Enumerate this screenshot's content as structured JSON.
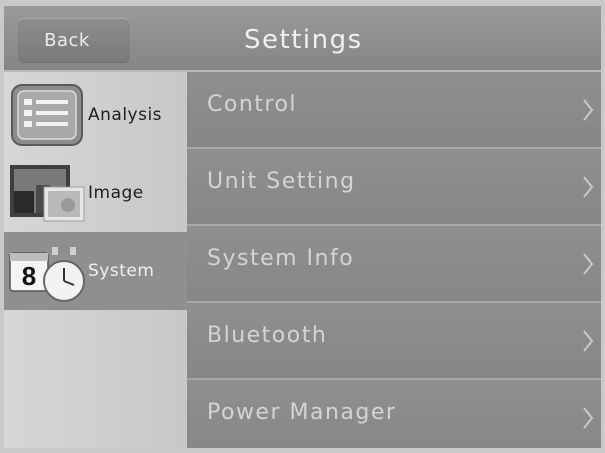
{
  "header": {
    "back_label": "Back",
    "title": "Settings"
  },
  "sidebar": {
    "items": [
      {
        "label": "Analysis",
        "icon": "analysis-list-icon",
        "active": false
      },
      {
        "label": "Image",
        "icon": "image-gallery-icon",
        "active": false
      },
      {
        "label": "System",
        "icon": "calendar-clock-icon",
        "active": true,
        "icon_text": "8"
      }
    ]
  },
  "main": {
    "items": [
      {
        "label": "Control"
      },
      {
        "label": "Unit Setting"
      },
      {
        "label": "System Info"
      },
      {
        "label": "Bluetooth"
      },
      {
        "label": "Power Manager"
      }
    ]
  },
  "colors": {
    "header_bg": "#8e8e8e",
    "sidebar_bg": "#d0d0d0",
    "active_item_bg": "#8f8f8f",
    "row_text": "#d4d4d4"
  }
}
